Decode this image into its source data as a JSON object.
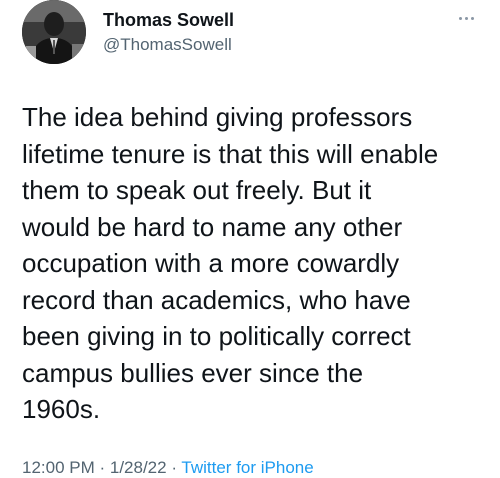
{
  "author": {
    "name": "Thomas Sowell",
    "handle": "@ThomasSowell"
  },
  "tweet": {
    "lines": [
      "The idea behind giving professors",
      "lifetime tenure is that this will enable",
      "them to speak out freely. But it",
      "would be hard to name any other",
      "occupation with a more cowardly",
      "record than academics, who have",
      "been giving in to politically correct",
      "campus bullies ever since the",
      "1960s."
    ]
  },
  "meta": {
    "time": "12:00 PM · 1/28/22 ·",
    "source": "Twitter for iPhone"
  },
  "icons": {
    "more": "more-horizontal-icon"
  },
  "colors": {
    "text": "#0f1419",
    "secondary": "#536471",
    "link": "#1d9bf0"
  }
}
